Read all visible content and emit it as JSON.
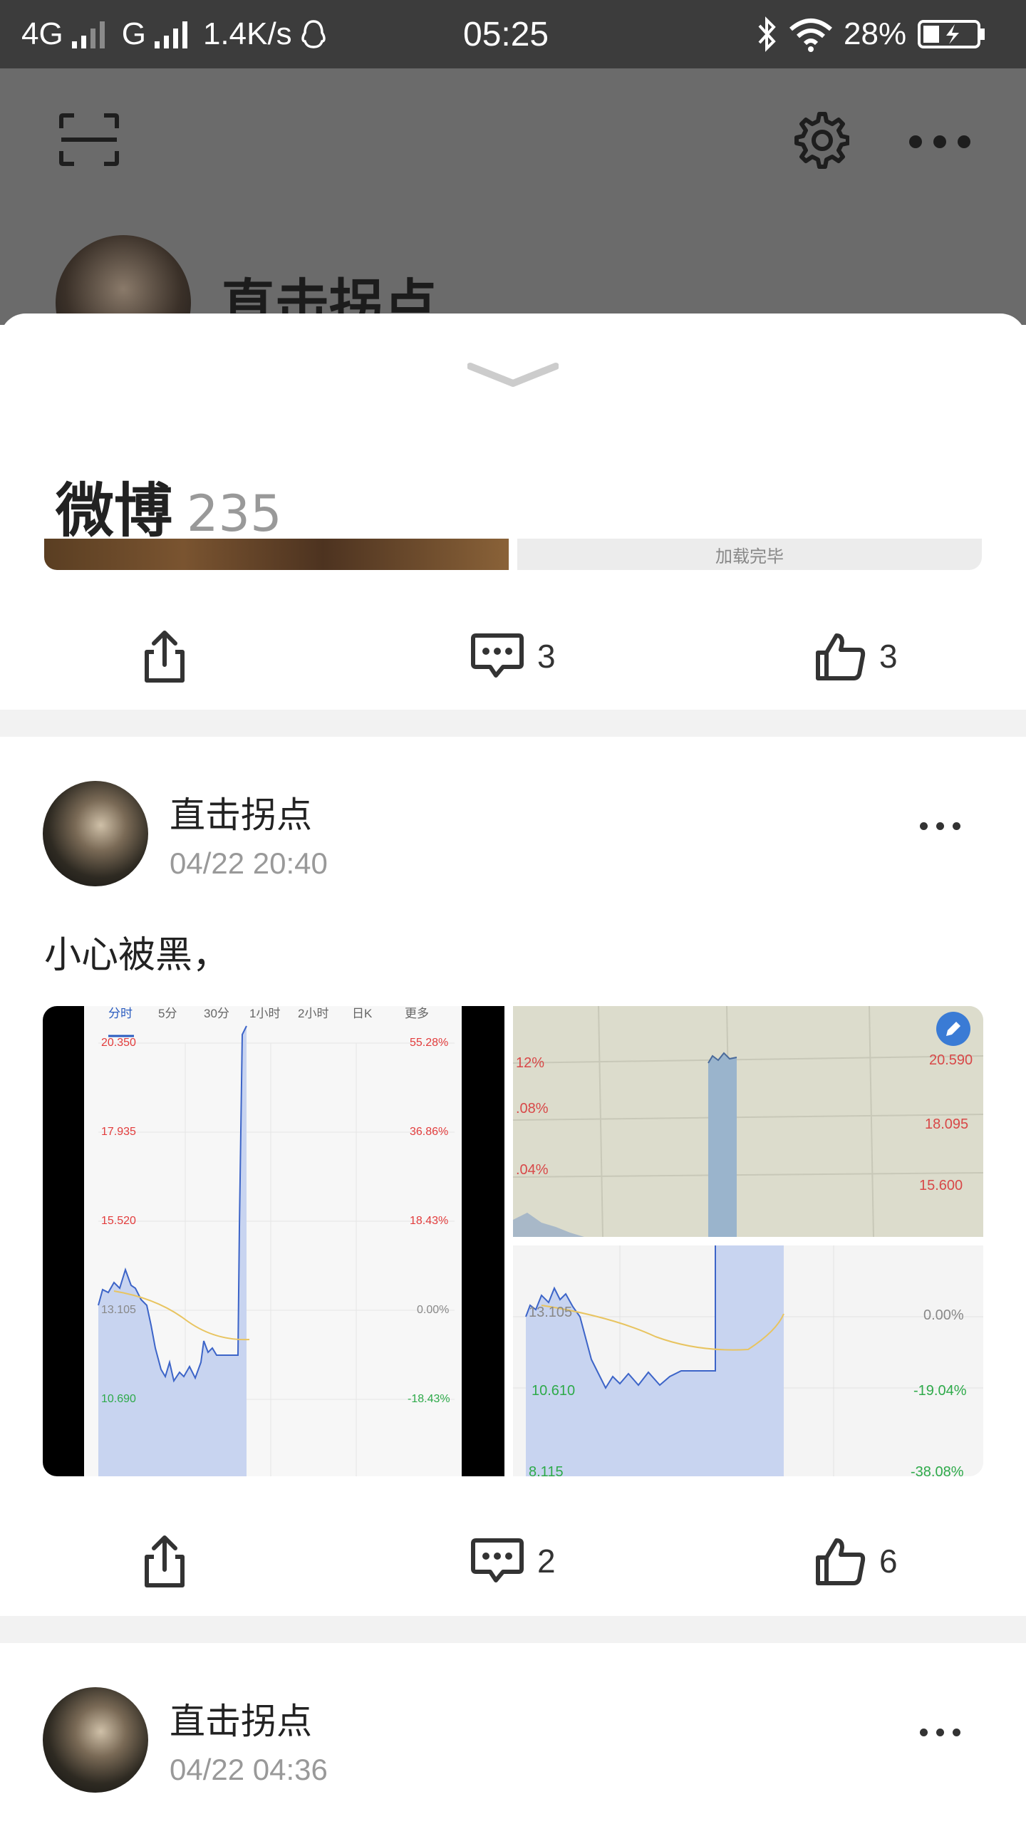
{
  "status_bar": {
    "network1": "4G",
    "network2": "G",
    "speed": "1.4K/s",
    "time": "05:25",
    "battery": "28%"
  },
  "profile_header": {
    "name": "直击拐点",
    "icons": [
      "scan-icon",
      "gear-icon",
      "more-icon"
    ]
  },
  "sheet": {
    "title": "微博",
    "count": "235",
    "loaded_text": "加载完毕"
  },
  "post0_actions": {
    "comments": "3",
    "likes": "3"
  },
  "posts": [
    {
      "author": "直击拐点",
      "time": "04/22 20:40",
      "text": "小心被黑，",
      "comments": "2",
      "likes": "6",
      "chart_left": {
        "tabs": [
          "分时",
          "5分",
          "30分",
          "1小时",
          "2小时",
          "日K",
          "更多"
        ],
        "prices": [
          "20.350",
          "17.935",
          "15.520",
          "13.105",
          "10.690"
        ],
        "percents": [
          "55.28%",
          "36.86%",
          "18.43%",
          "0.00%",
          "-18.43%"
        ]
      },
      "chart_top_right": {
        "left_labels": [
          "12%",
          ".08%",
          ".04%"
        ],
        "right_labels": [
          "20.590",
          "18.095",
          "15.600"
        ]
      },
      "chart_bottom_right": {
        "left_labels": [
          "13.105",
          "10.610",
          "8.115"
        ],
        "right_labels": [
          "0.00%",
          "-19.04%",
          "-38.08%"
        ]
      }
    },
    {
      "author": "直击拐点",
      "time": "04/22 04:36"
    }
  ],
  "colors": {
    "up": "#e23c3c",
    "down": "#2eaa4a",
    "line": "#3c64c8",
    "fill": "#c8d4f0"
  }
}
